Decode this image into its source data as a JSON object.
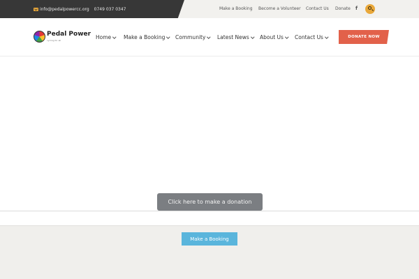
{
  "topbar": {
    "email": "info@pedalpowercc.org",
    "phone": "0749 037 0347",
    "links": [
      "Make a Booking",
      "Become a Volunteer",
      "Contact Us",
      "Donate"
    ],
    "facebook_glyph": "f",
    "icons": {
      "email": "mail-icon",
      "facebook": "facebook-icon",
      "search": "search-icon"
    }
  },
  "header": {
    "logo_name": "Pedal Power",
    "logo_tagline": "cycling for all",
    "nav": [
      "Home",
      "Make a Booking",
      "Community",
      "Latest News",
      "About Us",
      "Contact Us"
    ],
    "donate_label": "DONATE NOW"
  },
  "main": {
    "donation_button": "Click here to make a donation",
    "booking_button": "Make a Booking"
  },
  "colors": {
    "accent_orange": "#e9a83a",
    "donate_red": "#e2614a",
    "booking_blue": "#5ab5dc",
    "topbar_dark": "#373737"
  }
}
